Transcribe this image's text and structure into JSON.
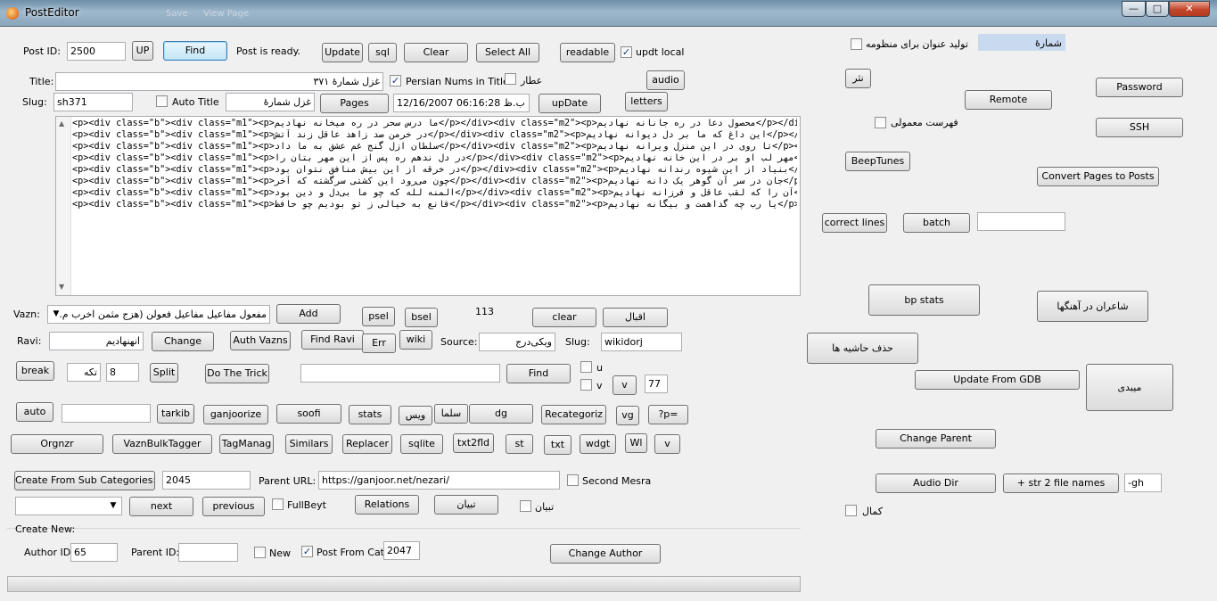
{
  "window": {
    "title": "PostEditor",
    "ghost_a": "Save",
    "ghost_b": "View Page"
  },
  "row1": {
    "post_id_label": "Post ID:",
    "post_id": "2500",
    "up": "UP",
    "find": "Find",
    "status": "Post is ready.",
    "update": "Update",
    "sql": "sql",
    "clear": "Clear",
    "select_all": "Select All",
    "readable": "readable",
    "updt_local": "updt local"
  },
  "title_row": {
    "label": "Title:",
    "value": "غزل شمارهٔ ۳۷۱",
    "persian_nums": "Persian Nums in Title",
    "attar": "عطار",
    "audio": "audio"
  },
  "slug_row": {
    "label": "Slug:",
    "value": "sh371",
    "auto_title": "Auto Title",
    "auto_value": "غزل شمارهٔ",
    "pages": "Pages",
    "date": "12/16/2007 06:16:28 ب.ظ",
    "update_date": "upDate",
    "letters": "letters"
  },
  "editor": {
    "lines": [
      "<p><div class=\"b\"><div class=\"m1\"><p>ما درس سحر در ره میخانه نهادیم</p></div><div class=\"m2\"><p>محصول دعا در ره جانانه نهادیم</p></div></div></p>",
      "<p><div class=\"b\"><div class=\"m1\"><p>در خرمن صد زاهد عاقل زند آتش</p></div><div class=\"m2\"><p>این داغ که ما بر دل دیوانه نهادیم</p></div></div></p>",
      "<p><div class=\"b\"><div class=\"m1\"><p>سلطان ازل گنج غم عشق به ما داد</p></div><div class=\"m2\"><p>تا روی در این منزل ویرانه نهادیم</p></div></div></p>",
      "<p><div class=\"b\"><div class=\"m1\"><p>در دل ندهم ره پس از این مهر بتان را</p></div><div class=\"m2\"><p>مهر لب او بر در این خانه نهادیم</p></div></div></p>",
      "<p><div class=\"b\"><div class=\"m1\"><p>در خرقه از این بیش منافق نتوان بود</p></div><div class=\"m2\"><p>بنیاد از این شیوه رندانه نهادیم</p></div></div></p>",
      "<p><div class=\"b\"><div class=\"m1\"><p>چون می‌رود این کشتی سرگشته که آخر</p></div><div class=\"m2\"><p>جان در سر آن گوهر یک دانه نهادیم</p></div></div></p>",
      "<p><div class=\"b\"><div class=\"m1\"><p>المنه لله که چو ما بی‌دل و دین بود</p></div><div class=\"m2\"><p>آن را که لقب عاقل و فرزانه نهادیم</p></div></div></p>",
      "<p><div class=\"b\"><div class=\"m1\"><p>قانع به خیالی ز تو بودیم چو حافظ</p></div><div class=\"m2\"><p>یا رب چه گداهمت و بیگانه نهادیم</p></div></div></p>"
    ]
  },
  "vazn": {
    "label": "Vazn:",
    "selected": "مفعول مفاعیل مفاعیل فعولن (هزج مثمن اخرب م.",
    "add": "Add",
    "psel": "psel",
    "bsel": "bsel",
    "count": "113",
    "clear": "clear",
    "aqbal": "اقبال"
  },
  "ravi": {
    "label": "Ravi:",
    "value": "انهنهادیم",
    "change": "Change",
    "auth_vazns": "Auth Vazns",
    "find_ravi": "Find Ravi",
    "err": "Err",
    "wiki": "wiki",
    "source_label": "Source:",
    "source": "ویکی‌درج",
    "slug_label": "Slug:",
    "slug": "wikidorj"
  },
  "break_row": {
    "break": "break",
    "tekke": "تکه",
    "num": "8",
    "split": "Split",
    "trick": "Do The Trick",
    "find_input": "",
    "find": "Find",
    "u": "u",
    "v": "v",
    "v_btn": "v",
    "num77": "77"
  },
  "auto_row": {
    "auto": "auto",
    "auto_input": "",
    "tarkib": "tarkib",
    "ganjoorize": "ganjoorize",
    "soofi": "soofi",
    "stats": "stats",
    "vis": "ویس",
    "salma": "سلما",
    "dg": "dg",
    "recategoriz": "Recategoriz",
    "vg": "vg",
    "p_eq": "?p="
  },
  "tools_row": {
    "orgnzr": "Orgnzr",
    "vazn_bulk": "VaznBulkTagger",
    "tag_manag": "TagManag",
    "similars": "Similars",
    "replacer": "Replacer",
    "sqlite": "sqlite",
    "txt2fld": "txt2fld",
    "st": "st",
    "txt": "txt",
    "wdgt": "wdgt",
    "wl": "Wl",
    "v": "v"
  },
  "create_row": {
    "create_sub": "Create From Sub Categories:",
    "cat_id": "2045",
    "parent_url_label": "Parent URL:",
    "parent_url": "https://ganjoor.net/nezari/",
    "second_mesra": "Second Mesra"
  },
  "nav_row": {
    "combo": "",
    "next": "next",
    "previous": "previous",
    "full_beyt": "FullBeyt",
    "relations": "Relations",
    "tebyan_btn": "تبیان",
    "tebyan_chk": "تبیان"
  },
  "create_new": {
    "group_label": "Create New:",
    "author_label": "Author ID:",
    "author_id": "65",
    "parent_label": "Parent ID:",
    "parent_id": "",
    "new": "New",
    "post_from_cat": "Post From Cat:",
    "cat": "2047",
    "change_author": "Change Author"
  },
  "right": {
    "monzume_label": "تولید عنوان برای منظومه",
    "monzume_value": "شمارهٔ",
    "nasr": "نثر",
    "remote": "Remote",
    "password": "Password",
    "fehrest": "فهرست معمولی",
    "ssh": "SSH",
    "beeptunes": "BeepTunes",
    "convert": "Convert Pages to Posts",
    "correct_lines": "correct lines",
    "batch": "batch",
    "batch_input": "",
    "bp_stats": "bp stats",
    "poets_songs": "شاعران در آهنگها",
    "del_margin": "حذف حاشیه ها",
    "update_gdb": "Update From GDB",
    "meybodi": "میبدی",
    "change_parent": "Change Parent",
    "audio_dir": "Audio Dir",
    "str2file": "+ str 2 file names",
    "gh": "-gh",
    "kamal": "کمال"
  }
}
